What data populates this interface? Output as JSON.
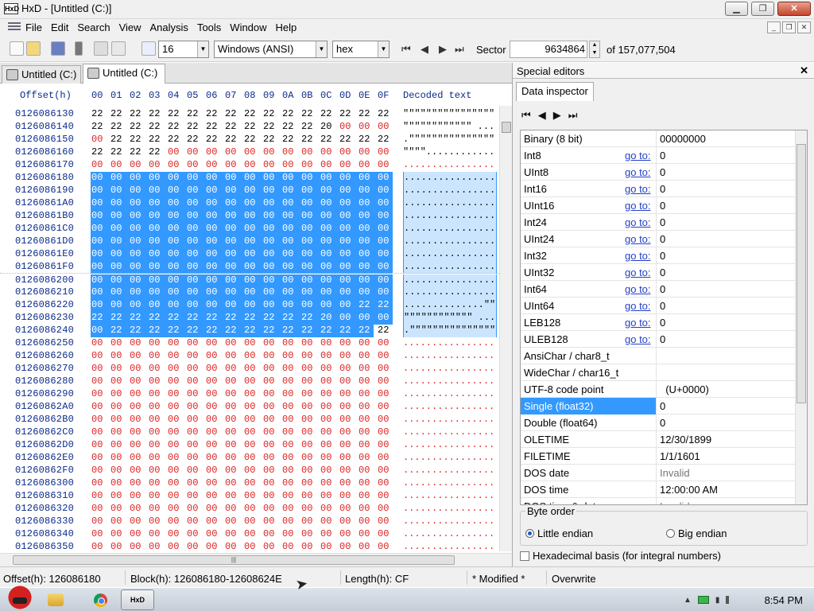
{
  "window": {
    "title": "HxD - [Untitled (C:)]",
    "app_icon": "HxD",
    "minimize": "▁",
    "maximize": "❐",
    "close": "✕"
  },
  "menu": {
    "items": [
      "File",
      "Edit",
      "Search",
      "View",
      "Analysis",
      "Tools",
      "Window",
      "Help"
    ],
    "mdi_buttons": [
      "_",
      "❐",
      "✕"
    ]
  },
  "toolbar": {
    "bytes_per_row": "16",
    "charset": "Windows (ANSI)",
    "offset_base": "hex",
    "sector_label": "Sector",
    "sector_value": "9634864",
    "sector_total": "of 157,077,504"
  },
  "tabs": [
    {
      "label": "Untitled (C:)",
      "active": false
    },
    {
      "label": "Untitled (C:)",
      "active": true
    }
  ],
  "hexview": {
    "offset_header": "Offset(h)",
    "column_headers": [
      "00",
      "01",
      "02",
      "03",
      "04",
      "05",
      "06",
      "07",
      "08",
      "09",
      "0A",
      "0B",
      "0C",
      "0D",
      "0E",
      "0F"
    ],
    "decoded_header": "Decoded text",
    "rows": [
      {
        "offset": "0126086130",
        "bytes": [
          "22",
          "22",
          "22",
          "22",
          "22",
          "22",
          "22",
          "22",
          "22",
          "22",
          "22",
          "22",
          "22",
          "22",
          "22",
          "22"
        ],
        "decoded": "\"\"\"\"\"\"\"\"\"\"\"\"\"\"\"\""
      },
      {
        "offset": "0126086140",
        "bytes": [
          "22",
          "22",
          "22",
          "22",
          "22",
          "22",
          "22",
          "22",
          "22",
          "22",
          "22",
          "22",
          "20",
          "00",
          "00",
          "00"
        ],
        "decoded": "\"\"\"\"\"\"\"\"\"\"\"\" ..."
      },
      {
        "offset": "0126086150",
        "bytes": [
          "00",
          "22",
          "22",
          "22",
          "22",
          "22",
          "22",
          "22",
          "22",
          "22",
          "22",
          "22",
          "22",
          "22",
          "22",
          "22"
        ],
        "decoded": ".\"\"\"\"\"\"\"\"\"\"\"\"\"\"\""
      },
      {
        "offset": "0126086160",
        "bytes": [
          "22",
          "22",
          "22",
          "22",
          "00",
          "00",
          "00",
          "00",
          "00",
          "00",
          "00",
          "00",
          "00",
          "00",
          "00",
          "00"
        ],
        "decoded": "\"\"\"\"............"
      },
      {
        "offset": "0126086170",
        "bytes": [
          "00",
          "00",
          "00",
          "00",
          "00",
          "00",
          "00",
          "00",
          "00",
          "00",
          "00",
          "00",
          "00",
          "00",
          "00",
          "00"
        ],
        "decoded": "................"
      },
      {
        "offset": "0126086180",
        "bytes": [
          "00",
          "00",
          "00",
          "00",
          "00",
          "00",
          "00",
          "00",
          "00",
          "00",
          "00",
          "00",
          "00",
          "00",
          "00",
          "00"
        ],
        "decoded": "................"
      },
      {
        "offset": "0126086190",
        "bytes": [
          "00",
          "00",
          "00",
          "00",
          "00",
          "00",
          "00",
          "00",
          "00",
          "00",
          "00",
          "00",
          "00",
          "00",
          "00",
          "00"
        ],
        "decoded": "................"
      },
      {
        "offset": "01260861A0",
        "bytes": [
          "00",
          "00",
          "00",
          "00",
          "00",
          "00",
          "00",
          "00",
          "00",
          "00",
          "00",
          "00",
          "00",
          "00",
          "00",
          "00"
        ],
        "decoded": "................"
      },
      {
        "offset": "01260861B0",
        "bytes": [
          "00",
          "00",
          "00",
          "00",
          "00",
          "00",
          "00",
          "00",
          "00",
          "00",
          "00",
          "00",
          "00",
          "00",
          "00",
          "00"
        ],
        "decoded": "................"
      },
      {
        "offset": "01260861C0",
        "bytes": [
          "00",
          "00",
          "00",
          "00",
          "00",
          "00",
          "00",
          "00",
          "00",
          "00",
          "00",
          "00",
          "00",
          "00",
          "00",
          "00"
        ],
        "decoded": "................"
      },
      {
        "offset": "01260861D0",
        "bytes": [
          "00",
          "00",
          "00",
          "00",
          "00",
          "00",
          "00",
          "00",
          "00",
          "00",
          "00",
          "00",
          "00",
          "00",
          "00",
          "00"
        ],
        "decoded": "................"
      },
      {
        "offset": "01260861E0",
        "bytes": [
          "00",
          "00",
          "00",
          "00",
          "00",
          "00",
          "00",
          "00",
          "00",
          "00",
          "00",
          "00",
          "00",
          "00",
          "00",
          "00"
        ],
        "decoded": "................"
      },
      {
        "offset": "01260861F0",
        "bytes": [
          "00",
          "00",
          "00",
          "00",
          "00",
          "00",
          "00",
          "00",
          "00",
          "00",
          "00",
          "00",
          "00",
          "00",
          "00",
          "00"
        ],
        "decoded": "................"
      },
      {
        "offset": "0126086200",
        "bytes": [
          "00",
          "00",
          "00",
          "00",
          "00",
          "00",
          "00",
          "00",
          "00",
          "00",
          "00",
          "00",
          "00",
          "00",
          "00",
          "00"
        ],
        "decoded": "................"
      },
      {
        "offset": "0126086210",
        "bytes": [
          "00",
          "00",
          "00",
          "00",
          "00",
          "00",
          "00",
          "00",
          "00",
          "00",
          "00",
          "00",
          "00",
          "00",
          "00",
          "00"
        ],
        "decoded": "................"
      },
      {
        "offset": "0126086220",
        "bytes": [
          "00",
          "00",
          "00",
          "00",
          "00",
          "00",
          "00",
          "00",
          "00",
          "00",
          "00",
          "00",
          "00",
          "00",
          "22",
          "22"
        ],
        "decoded": "..............\"\""
      },
      {
        "offset": "0126086230",
        "bytes": [
          "22",
          "22",
          "22",
          "22",
          "22",
          "22",
          "22",
          "22",
          "22",
          "22",
          "22",
          "22",
          "20",
          "00",
          "00",
          "00"
        ],
        "decoded": "\"\"\"\"\"\"\"\"\"\"\"\" ..."
      },
      {
        "offset": "0126086240",
        "bytes": [
          "00",
          "22",
          "22",
          "22",
          "22",
          "22",
          "22",
          "22",
          "22",
          "22",
          "22",
          "22",
          "22",
          "22",
          "22",
          "22"
        ],
        "decoded": ".\"\"\"\"\"\"\"\"\"\"\"\"\"\"\""
      },
      {
        "offset": "0126086250",
        "bytes": [
          "00",
          "00",
          "00",
          "00",
          "00",
          "00",
          "00",
          "00",
          "00",
          "00",
          "00",
          "00",
          "00",
          "00",
          "00",
          "00"
        ],
        "decoded": "................"
      },
      {
        "offset": "0126086260",
        "bytes": [
          "00",
          "00",
          "00",
          "00",
          "00",
          "00",
          "00",
          "00",
          "00",
          "00",
          "00",
          "00",
          "00",
          "00",
          "00",
          "00"
        ],
        "decoded": "................"
      },
      {
        "offset": "0126086270",
        "bytes": [
          "00",
          "00",
          "00",
          "00",
          "00",
          "00",
          "00",
          "00",
          "00",
          "00",
          "00",
          "00",
          "00",
          "00",
          "00",
          "00"
        ],
        "decoded": "................"
      },
      {
        "offset": "0126086280",
        "bytes": [
          "00",
          "00",
          "00",
          "00",
          "00",
          "00",
          "00",
          "00",
          "00",
          "00",
          "00",
          "00",
          "00",
          "00",
          "00",
          "00"
        ],
        "decoded": "................"
      },
      {
        "offset": "0126086290",
        "bytes": [
          "00",
          "00",
          "00",
          "00",
          "00",
          "00",
          "00",
          "00",
          "00",
          "00",
          "00",
          "00",
          "00",
          "00",
          "00",
          "00"
        ],
        "decoded": "................"
      },
      {
        "offset": "01260862A0",
        "bytes": [
          "00",
          "00",
          "00",
          "00",
          "00",
          "00",
          "00",
          "00",
          "00",
          "00",
          "00",
          "00",
          "00",
          "00",
          "00",
          "00"
        ],
        "decoded": "................"
      },
      {
        "offset": "01260862B0",
        "bytes": [
          "00",
          "00",
          "00",
          "00",
          "00",
          "00",
          "00",
          "00",
          "00",
          "00",
          "00",
          "00",
          "00",
          "00",
          "00",
          "00"
        ],
        "decoded": "................"
      },
      {
        "offset": "01260862C0",
        "bytes": [
          "00",
          "00",
          "00",
          "00",
          "00",
          "00",
          "00",
          "00",
          "00",
          "00",
          "00",
          "00",
          "00",
          "00",
          "00",
          "00"
        ],
        "decoded": "................"
      },
      {
        "offset": "01260862D0",
        "bytes": [
          "00",
          "00",
          "00",
          "00",
          "00",
          "00",
          "00",
          "00",
          "00",
          "00",
          "00",
          "00",
          "00",
          "00",
          "00",
          "00"
        ],
        "decoded": "................"
      },
      {
        "offset": "01260862E0",
        "bytes": [
          "00",
          "00",
          "00",
          "00",
          "00",
          "00",
          "00",
          "00",
          "00",
          "00",
          "00",
          "00",
          "00",
          "00",
          "00",
          "00"
        ],
        "decoded": "................"
      },
      {
        "offset": "01260862F0",
        "bytes": [
          "00",
          "00",
          "00",
          "00",
          "00",
          "00",
          "00",
          "00",
          "00",
          "00",
          "00",
          "00",
          "00",
          "00",
          "00",
          "00"
        ],
        "decoded": "................"
      },
      {
        "offset": "0126086300",
        "bytes": [
          "00",
          "00",
          "00",
          "00",
          "00",
          "00",
          "00",
          "00",
          "00",
          "00",
          "00",
          "00",
          "00",
          "00",
          "00",
          "00"
        ],
        "decoded": "................"
      },
      {
        "offset": "0126086310",
        "bytes": [
          "00",
          "00",
          "00",
          "00",
          "00",
          "00",
          "00",
          "00",
          "00",
          "00",
          "00",
          "00",
          "00",
          "00",
          "00",
          "00"
        ],
        "decoded": "................"
      },
      {
        "offset": "0126086320",
        "bytes": [
          "00",
          "00",
          "00",
          "00",
          "00",
          "00",
          "00",
          "00",
          "00",
          "00",
          "00",
          "00",
          "00",
          "00",
          "00",
          "00"
        ],
        "decoded": "................"
      },
      {
        "offset": "0126086330",
        "bytes": [
          "00",
          "00",
          "00",
          "00",
          "00",
          "00",
          "00",
          "00",
          "00",
          "00",
          "00",
          "00",
          "00",
          "00",
          "00",
          "00"
        ],
        "decoded": "................"
      },
      {
        "offset": "0126086340",
        "bytes": [
          "00",
          "00",
          "00",
          "00",
          "00",
          "00",
          "00",
          "00",
          "00",
          "00",
          "00",
          "00",
          "00",
          "00",
          "00",
          "00"
        ],
        "decoded": "................"
      },
      {
        "offset": "0126086350",
        "bytes": [
          "00",
          "00",
          "00",
          "00",
          "00",
          "00",
          "00",
          "00",
          "00",
          "00",
          "00",
          "00",
          "00",
          "00",
          "00",
          "00"
        ],
        "decoded": "................"
      }
    ],
    "selection_start": "0126086180",
    "selection_end_offset": "0126086240",
    "selection_end_col": 14
  },
  "special_editors": {
    "title": "Special editors",
    "close": "✕",
    "tab": "Data inspector",
    "nav": [
      "⏮",
      "◀",
      "▶",
      "⏭"
    ],
    "goto_label": "go to:",
    "rows": [
      {
        "name": "Binary (8 bit)",
        "value": "00000000",
        "goto": false
      },
      {
        "name": "Int8",
        "value": "0",
        "goto": true
      },
      {
        "name": "UInt8",
        "value": "0",
        "goto": true
      },
      {
        "name": "Int16",
        "value": "0",
        "goto": true
      },
      {
        "name": "UInt16",
        "value": "0",
        "goto": true
      },
      {
        "name": "Int24",
        "value": "0",
        "goto": true
      },
      {
        "name": "UInt24",
        "value": "0",
        "goto": true
      },
      {
        "name": "Int32",
        "value": "0",
        "goto": true
      },
      {
        "name": "UInt32",
        "value": "0",
        "goto": true
      },
      {
        "name": "Int64",
        "value": "0",
        "goto": true
      },
      {
        "name": "UInt64",
        "value": "0",
        "goto": true
      },
      {
        "name": "LEB128",
        "value": "0",
        "goto": true
      },
      {
        "name": "ULEB128",
        "value": "0",
        "goto": true
      },
      {
        "name": "AnsiChar / char8_t",
        "value": "",
        "goto": false
      },
      {
        "name": "WideChar / char16_t",
        "value": "",
        "goto": false
      },
      {
        "name": "UTF-8 code point",
        "value": "  (U+0000)",
        "goto": false
      },
      {
        "name": "Single (float32)",
        "value": "0",
        "goto": false,
        "selected": true
      },
      {
        "name": "Double (float64)",
        "value": "0",
        "goto": false
      },
      {
        "name": "OLETIME",
        "value": "12/30/1899",
        "goto": false
      },
      {
        "name": "FILETIME",
        "value": "1/1/1601",
        "goto": false
      },
      {
        "name": "DOS date",
        "value": "Invalid",
        "goto": false,
        "gray": true
      },
      {
        "name": "DOS time",
        "value": "12:00:00 AM",
        "goto": false
      },
      {
        "name": "DOS time & date",
        "value": "Invalid",
        "goto": false,
        "gray": true
      }
    ],
    "byte_order_label": "Byte order",
    "little_endian": "Little endian",
    "big_endian": "Big endian",
    "hex_basis": "Hexadecimal basis (for integral numbers)"
  },
  "status": {
    "offset": "Offset(h): 126086180",
    "block": "Block(h): 126086180-12608624E",
    "length": "Length(h): CF",
    "modified": "* Modified *",
    "mode": "Overwrite"
  },
  "taskbar": {
    "clock": "8:54 PM",
    "hxd_label": "HxD"
  },
  "colors": {
    "selection": "#3399ff",
    "zero_byte": "#dd2222",
    "offset_text": "#0b2a8a"
  }
}
